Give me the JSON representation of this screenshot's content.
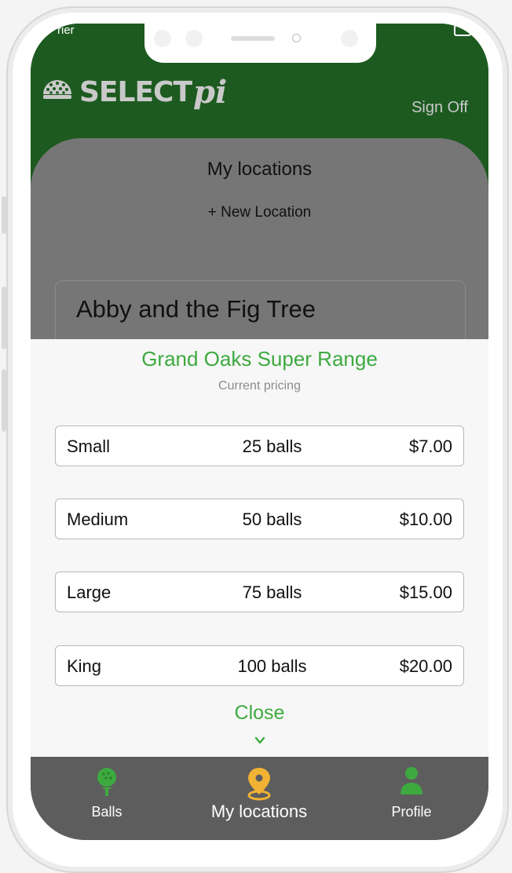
{
  "status": {
    "carrier": "rier"
  },
  "brand": {
    "name": "SELECT",
    "suffix": "pi"
  },
  "header": {
    "sign_off": "Sign Off"
  },
  "content": {
    "title": "My locations",
    "new_location": "+ New Location",
    "locations": [
      {
        "name": "Abby and the Fig Tree"
      }
    ]
  },
  "sheet": {
    "title": "Grand Oaks Super Range",
    "subtitle": "Current pricing",
    "options": [
      {
        "size": "Small",
        "balls": "25 balls",
        "price": "$7.00"
      },
      {
        "size": "Medium",
        "balls": "50 balls",
        "price": "$10.00"
      },
      {
        "size": "Large",
        "balls": "75 balls",
        "price": "$15.00"
      },
      {
        "size": "King",
        "balls": "100 balls",
        "price": "$20.00"
      }
    ],
    "close_label": "Close"
  },
  "tabs": [
    {
      "label": "Balls",
      "icon": "golf-ball-tee-icon"
    },
    {
      "label": "My locations",
      "icon": "map-pin-icon"
    },
    {
      "label": "Profile",
      "icon": "person-icon"
    }
  ],
  "colors": {
    "header_green": "#1d5a20",
    "accent_green": "#3daa3f",
    "pin_yellow": "#f2b233",
    "tabbar_gray": "#5d5d5d"
  }
}
